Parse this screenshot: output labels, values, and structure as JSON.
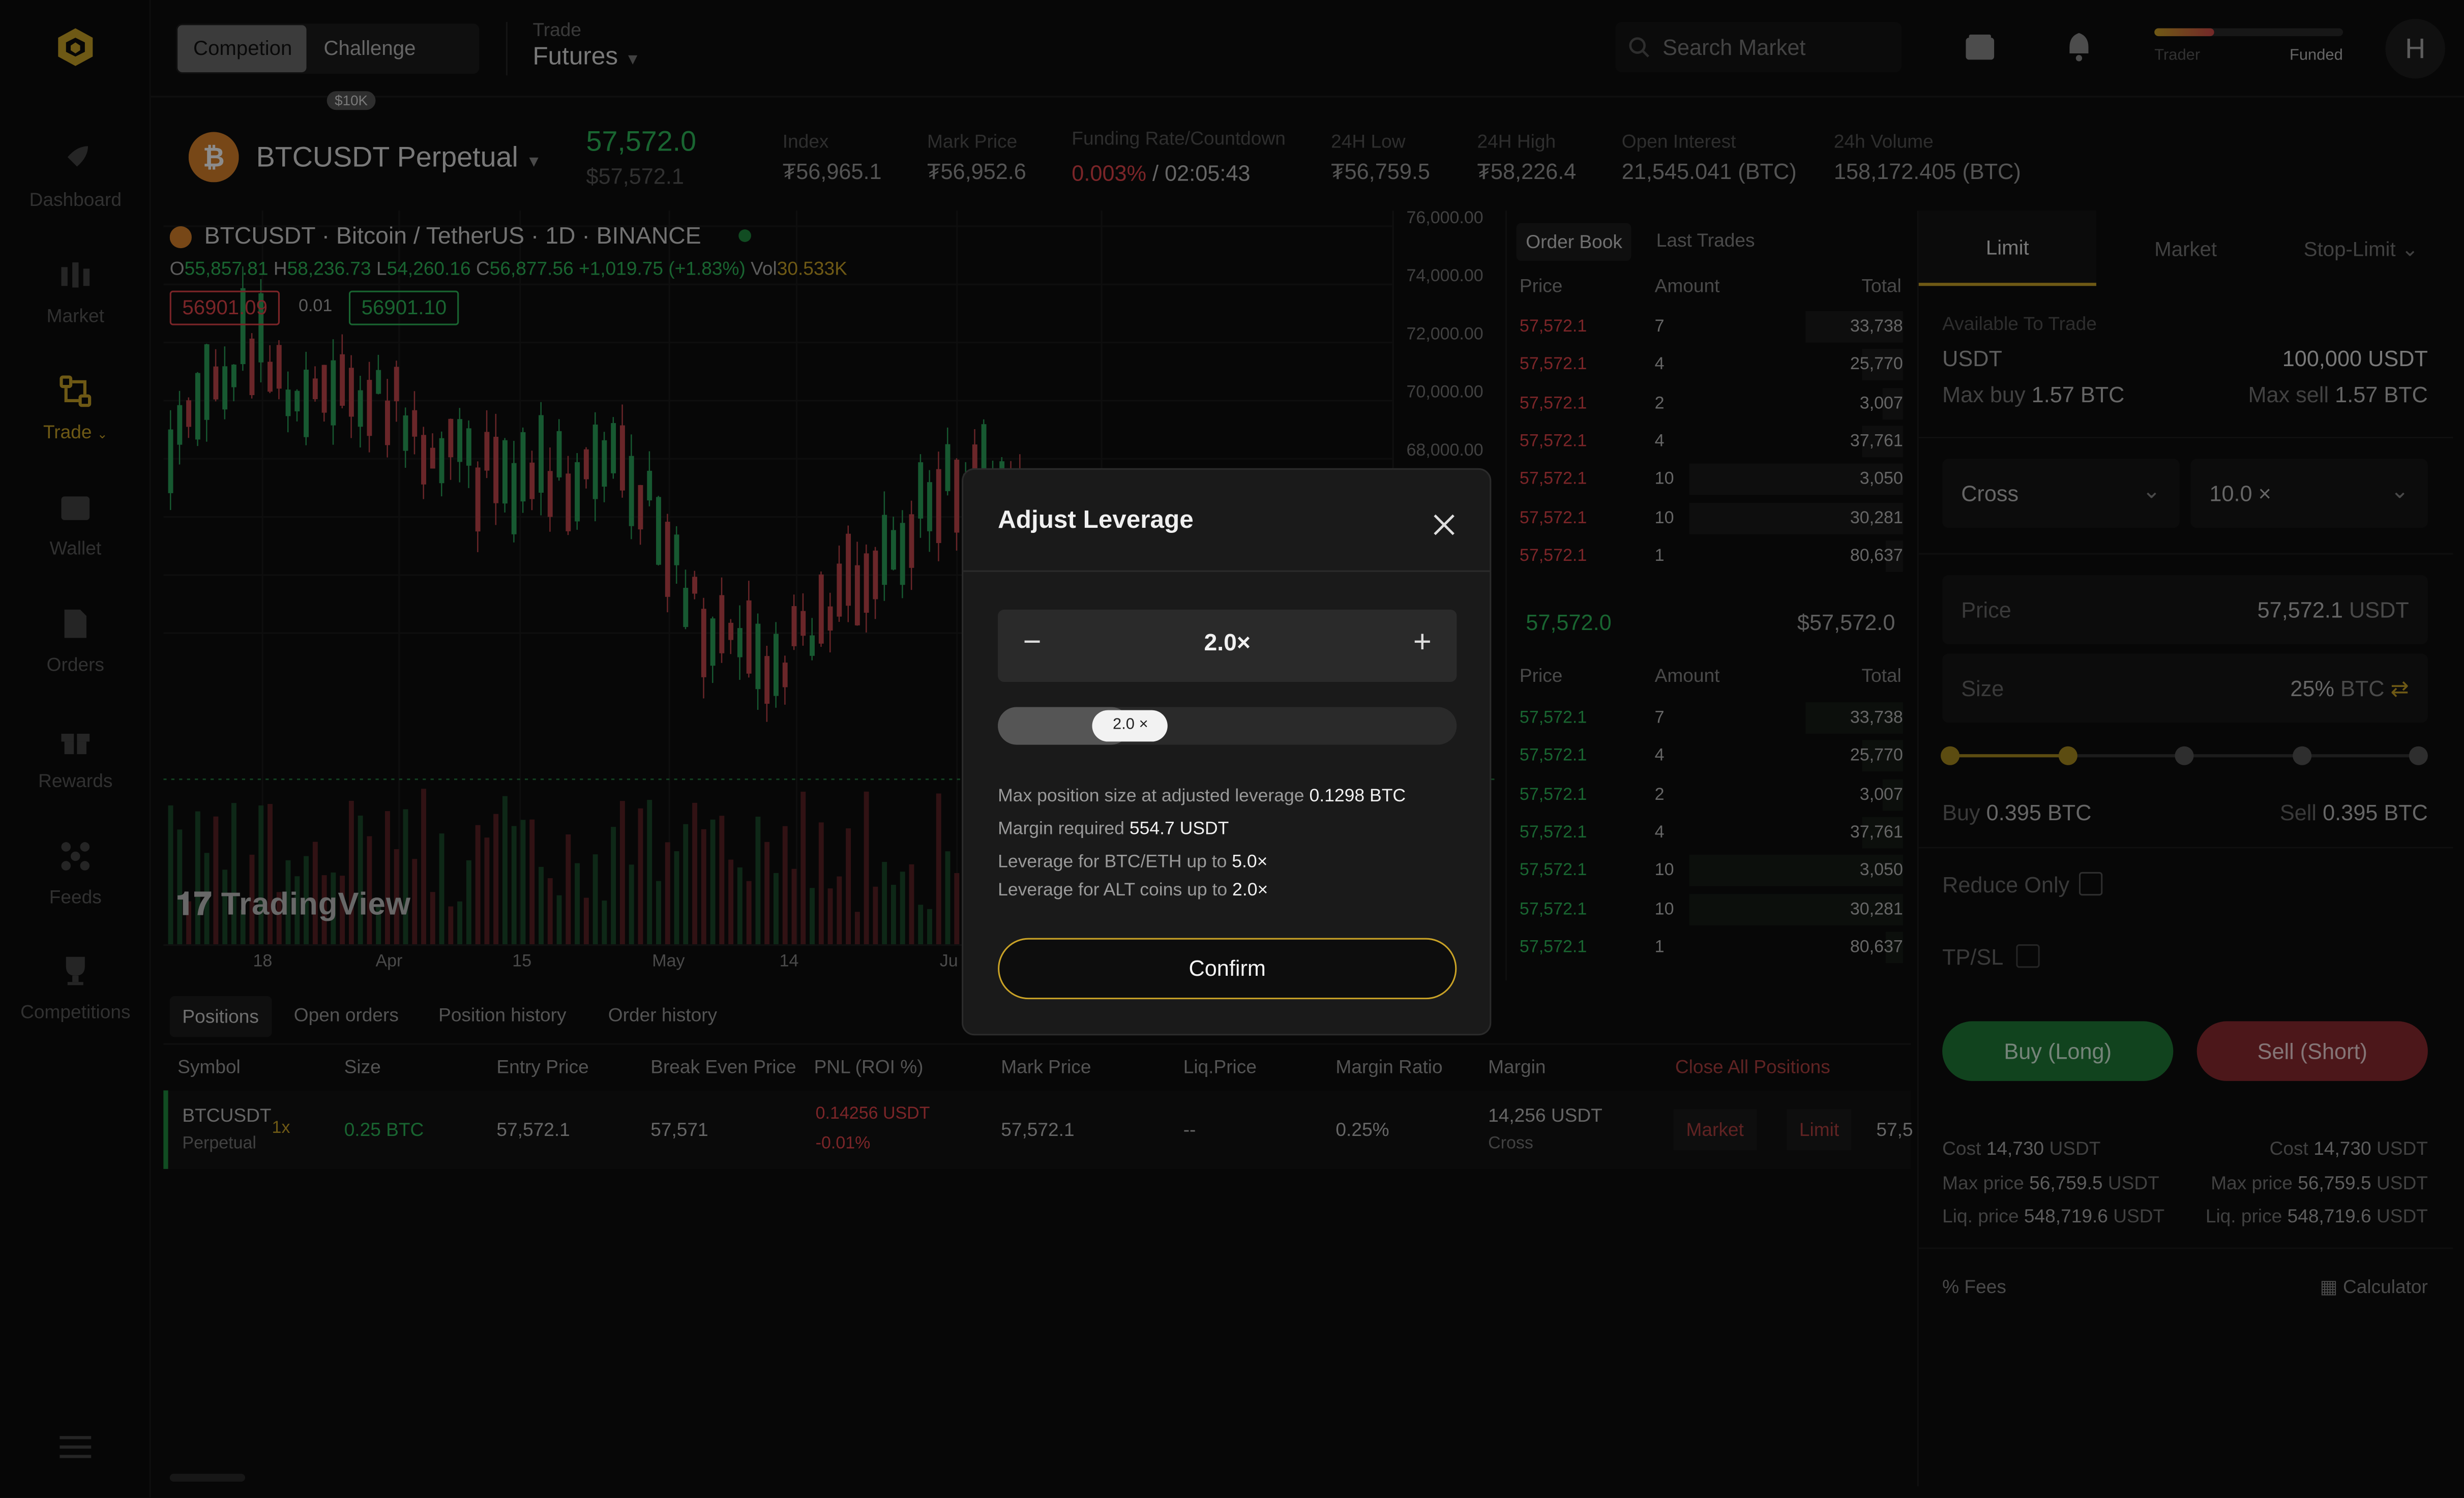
{
  "header": {
    "seg_left": "Competion",
    "seg_right": "Challenge",
    "seg_badge": "$10K",
    "trade_label": "Trade",
    "trade_value": "Futures",
    "search_placeholder": "Search Market",
    "progress_left": "Trader",
    "progress_right": "Funded",
    "avatar_letter": "H"
  },
  "sidebar": {
    "items": [
      {
        "label": "Dashboard",
        "icon": "rocket-icon"
      },
      {
        "label": "Market",
        "icon": "candles-icon"
      },
      {
        "label": "Trade",
        "icon": "trade-icon"
      },
      {
        "label": "Wallet",
        "icon": "wallet-icon"
      },
      {
        "label": "Orders",
        "icon": "document-icon"
      },
      {
        "label": "Rewards",
        "icon": "gift-icon"
      },
      {
        "label": "Feeds",
        "icon": "feeds-icon"
      },
      {
        "label": "Competitions",
        "icon": "trophy-icon"
      }
    ]
  },
  "ticker": {
    "symbol": "BTCUSDT Perpetual",
    "price": "57,572.0",
    "price_sub": "$57,572.1",
    "index_label": "Index",
    "index_val": "₮56,965.1",
    "mark_label": "Mark Price",
    "mark_val": "₮56,952.6",
    "funding_label": "Funding Rate/Countdown",
    "funding_rate": "0.003%",
    "funding_sep": "/",
    "funding_countdown": "02:05:43",
    "low_label": "24H Low",
    "low_val": "₮56,759.5",
    "high_label": "24H High",
    "high_val": "₮58,226.4",
    "oi_label": "Open Interest",
    "oi_val": "21,545.041 (BTC)",
    "vol_label": "24h Volume",
    "vol_val": "158,172.405 (BTC)"
  },
  "chart": {
    "title": "BTCUSDT · Bitcoin / TetherUS · 1D · BINANCE",
    "o_label": "O",
    "o_val": "55,857.81",
    "h_label": "H",
    "h_val": "58,236.73",
    "l_label": "L",
    "l_val": "54,260.16",
    "c_label": "C",
    "c_val": "56,877.56",
    "change": "+1,019.75 (+1.83%)",
    "vol_label": "Vol",
    "vol_val": "30.533K",
    "sell_box": "56901.09",
    "spread": "0.01",
    "buy_box": "56901.10",
    "watermark": "TradingView",
    "y_ticks": [
      "76,000.00",
      "74,000.00",
      "72,000.00",
      "70,000.00",
      "68,000.00"
    ],
    "x_ticks": [
      "18",
      "Apr",
      "15",
      "May",
      "14",
      "Ju"
    ]
  },
  "orderbook": {
    "tab_book": "Order Book",
    "tab_trades": "Last Trades",
    "col_price": "Price",
    "col_amount": "Amount",
    "col_total": "Total",
    "asks": [
      {
        "price": "57,572.1",
        "amount": "7",
        "total": "33,738",
        "depth": 0.28
      },
      {
        "price": "57,572.1",
        "amount": "4",
        "total": "25,770",
        "depth": 0.12
      },
      {
        "price": "57,572.1",
        "amount": "2",
        "total": "3,007",
        "depth": 0.06
      },
      {
        "price": "57,572.1",
        "amount": "4",
        "total": "37,761",
        "depth": 0.12
      },
      {
        "price": "57,572.1",
        "amount": "10",
        "total": "3,050",
        "depth": 0.62
      },
      {
        "price": "57,572.1",
        "amount": "10",
        "total": "30,281",
        "depth": 0.62
      },
      {
        "price": "57,572.1",
        "amount": "1",
        "total": "80,637",
        "depth": 0.05
      }
    ],
    "mid_price": "57,572.0",
    "mid_usd": "$57,572.0",
    "bids": [
      {
        "price": "57,572.1",
        "amount": "7",
        "total": "33,738",
        "depth": 0.28
      },
      {
        "price": "57,572.1",
        "amount": "4",
        "total": "25,770",
        "depth": 0.12
      },
      {
        "price": "57,572.1",
        "amount": "2",
        "total": "3,007",
        "depth": 0.06
      },
      {
        "price": "57,572.1",
        "amount": "4",
        "total": "37,761",
        "depth": 0.12
      },
      {
        "price": "57,572.1",
        "amount": "10",
        "total": "3,050",
        "depth": 0.62
      },
      {
        "price": "57,572.1",
        "amount": "10",
        "total": "30,281",
        "depth": 0.62
      },
      {
        "price": "57,572.1",
        "amount": "1",
        "total": "80,637",
        "depth": 0.05
      }
    ]
  },
  "order_panel": {
    "tab_limit": "Limit",
    "tab_market": "Market",
    "tab_stop": "Stop-Limit",
    "avail_label": "Available To Trade",
    "currency": "USDT",
    "avail_val": "100,000 USDT",
    "max_buy_label": "Max buy",
    "max_buy_val": "1.57 BTC",
    "max_sell_label": "Max sell",
    "max_sell_val": "1.57 BTC",
    "margin_mode": "Cross",
    "leverage": "10.0 ×",
    "price_label": "Price",
    "price_val": "57,572.1",
    "price_unit": "USDT",
    "size_label": "Size",
    "size_pct": "25%",
    "size_unit": "BTC",
    "size_fraction": 0.25,
    "buy_label": "Buy",
    "buy_val": "0.395 BTC",
    "sell_label": "Sell",
    "sell_val": "0.395 BTC",
    "reduce_only": "Reduce Only",
    "tpsl": "TP/SL",
    "buy_btn": "Buy (Long)",
    "sell_btn": "Sell (Short)",
    "cost_label": "Cost",
    "cost_val": "14,730",
    "maxprice_label": "Max price",
    "maxprice_val": "56,759.5",
    "liq_label": "Liq. price",
    "liq_val": "548,719.6",
    "unit": "USDT",
    "fees": "Fees",
    "calculator": "Calculator"
  },
  "positions": {
    "tabs": [
      "Positions",
      "Open orders",
      "Position history",
      "Order history"
    ],
    "cols": [
      "Symbol",
      "Size",
      "Entry Price",
      "Break Even Price",
      "PNL (ROI %)",
      "Mark Price",
      "Liq.Price",
      "Margin Ratio",
      "Margin"
    ],
    "close_all": "Close All Positions",
    "row": {
      "symbol": "BTCUSDT",
      "type": "Perpetual",
      "lev": "1x",
      "size": "0.25 BTC",
      "entry": "57,572.1",
      "breakeven": "57,571",
      "pnl": "0.14256 USDT",
      "roi": "-0.01%",
      "mark": "57,572.1",
      "liq": "--",
      "margin_ratio": "0.25%",
      "margin": "14,256 USDT",
      "margin_mode": "Cross",
      "btn_market": "Market",
      "btn_limit": "Limit",
      "cut_val": "57,5"
    }
  },
  "modal": {
    "title": "Adjust Leverage",
    "value": "2.0×",
    "slider_label": "2.0 ×",
    "slider_fraction": 0.2,
    "line1_label": "Max position size at adjusted leverage",
    "line1_val": "0.1298 BTC",
    "line2_label": "Margin required",
    "line2_val": "554.7 USDT",
    "line3_label": "Leverage for BTC/ETH up to",
    "line3_val": "5.0×",
    "line4_label": "Leverage for ALT coins up to",
    "line4_val": "2.0×",
    "confirm": "Confirm"
  },
  "colors": {
    "accent": "#c9a227",
    "green": "#2fb85a",
    "red": "#e0444a",
    "buy": "#1f7a37",
    "sell": "#8a2a30"
  }
}
